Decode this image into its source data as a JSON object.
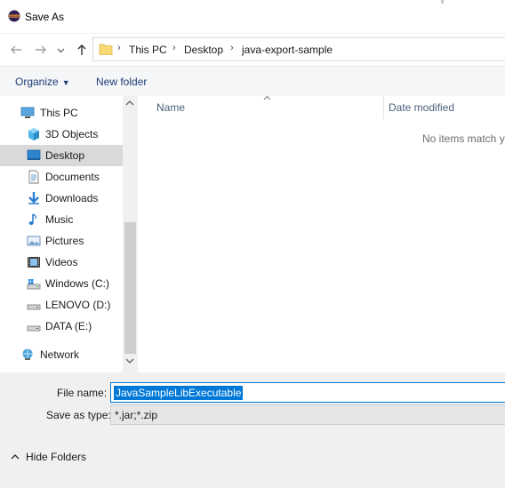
{
  "window": {
    "title": "Save As",
    "app_icon": "eclipse-icon"
  },
  "nav": {
    "back_icon": "arrow-left-icon",
    "forward_icon": "arrow-right-icon",
    "recent_icon": "chevron-down-icon",
    "up_icon": "arrow-up-icon"
  },
  "address": {
    "folder_icon": "folder-icon",
    "crumbs": [
      "This PC",
      "Desktop",
      "java-export-sample"
    ]
  },
  "commands": {
    "organize": "Organize",
    "new_folder": "New folder"
  },
  "sidebar": {
    "items": [
      {
        "label": "This PC",
        "icon": "computer-icon"
      },
      {
        "label": "3D Objects",
        "icon": "cube-icon"
      },
      {
        "label": "Desktop",
        "icon": "desktop-icon",
        "selected": true
      },
      {
        "label": "Documents",
        "icon": "document-icon"
      },
      {
        "label": "Downloads",
        "icon": "download-icon"
      },
      {
        "label": "Music",
        "icon": "music-note-icon"
      },
      {
        "label": "Pictures",
        "icon": "picture-icon"
      },
      {
        "label": "Videos",
        "icon": "film-icon"
      },
      {
        "label": "Windows (C:)",
        "icon": "drive-icon"
      },
      {
        "label": "LENOVO (D:)",
        "icon": "drive-icon"
      },
      {
        "label": "DATA (E:)",
        "icon": "drive-icon"
      },
      {
        "label": "Network",
        "icon": "network-icon"
      }
    ]
  },
  "files": {
    "columns": [
      "Name",
      "Date modified"
    ],
    "empty_message": "No items match y"
  },
  "form": {
    "file_name_label": "File name:",
    "file_name_value": "JavaSampleLibExecutable",
    "save_type_label": "Save as type:",
    "save_type_value": "*.jar;*.zip"
  },
  "footer": {
    "hide_folders": "Hide Folders"
  },
  "colors": {
    "accent": "#0078d7",
    "selected_bg": "#d9d9d9",
    "link": "#1e3c78"
  }
}
